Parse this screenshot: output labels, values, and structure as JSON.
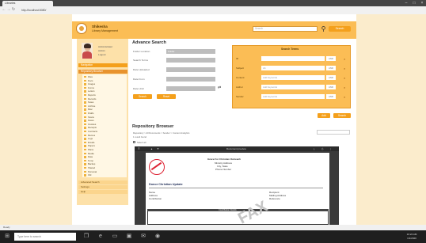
{
  "browser": {
    "tab_title": "Libraries",
    "url": "http://localhost:8080/",
    "nav_icons": [
      "back-icon",
      "forward-icon",
      "refresh-icon",
      "home-icon"
    ]
  },
  "header": {
    "brand_line1": "Shikesha",
    "brand_line2": "Library Management",
    "search_placeholder": "Search",
    "search_button": "Search"
  },
  "user": {
    "lines": [
      "Administrator",
      "Admin",
      "Logout"
    ]
  },
  "sidebar": {
    "head_label": "Navigation",
    "selected_label": "Repository Browser",
    "tree_items": [
      "Files",
      "Docs",
      "Images",
      "Forms",
      "Letters",
      "Reports",
      "Records",
      "Notes",
      "Archive",
      "Misc",
      "Drafts",
      "Scans",
      "Faxes",
      "Invoices",
      "Receipts",
      "Contracts",
      "Memos",
      "Logs",
      "Emails",
      "Papers",
      "Plans",
      "Media",
      "Data",
      "Temp",
      "Backup",
      "Shared",
      "Personal",
      "Old"
    ],
    "footer_items": [
      "Advanced Search",
      "Settings",
      "Help"
    ]
  },
  "advanced_search": {
    "title": "Advance Search",
    "fields": [
      {
        "label": "Folder Location",
        "value": "Folder"
      },
      {
        "label": "Search Terms",
        "value": ""
      },
      {
        "label": "Date Uploaded",
        "value": ""
      },
      {
        "label": "Date From",
        "value": ""
      },
      {
        "label": "Date Until",
        "value": ""
      }
    ],
    "search_button": "Search",
    "reset_button": "Reset"
  },
  "search_panel": {
    "title": "Search Terms",
    "rows": [
      {
        "label": "ID",
        "value": "",
        "select": "AND"
      },
      {
        "label": "Subject",
        "value": "Ab",
        "select": "AND"
      },
      {
        "label": "Content",
        "value": "Add Keywords",
        "select": "AND"
      },
      {
        "label": "Author",
        "value": "Add Keywords",
        "select": "AND"
      },
      {
        "label": "Sender",
        "value": "Add Keywords",
        "select": "AND"
      }
    ],
    "add_button": "Add",
    "search_button": "Search"
  },
  "repository": {
    "title": "Repository Browser",
    "meta_line1": "Repository > All Documents > Sender > Content Analytics",
    "meta_line2": "1 result found",
    "select_all_label": "Select all"
  },
  "viewer": {
    "toolbar_label": "Document preview",
    "doc_header_lines": [
      "Grace For Christian Outreach",
      "Ministry Address",
      "City, State",
      "Phone Number"
    ],
    "doc_section": "Donor Christian Update",
    "doc_left_labels": [
      "Name",
      "Address",
      "Contribution"
    ],
    "doc_right_labels": [
      "Recipient",
      "Mailing Address",
      "Reference"
    ],
    "table_header": "Contribution Details",
    "watermark": "FAX"
  },
  "status_bar": {
    "text": "Ready"
  },
  "taskbar": {
    "search_placeholder": "Type here to search",
    "time": "10:24 AM",
    "date": "1/1/2020",
    "icons": [
      "windows-icon",
      "task-view-icon",
      "edge-icon",
      "folder-icon",
      "store-icon",
      "mail-icon",
      "chrome-icon"
    ]
  }
}
